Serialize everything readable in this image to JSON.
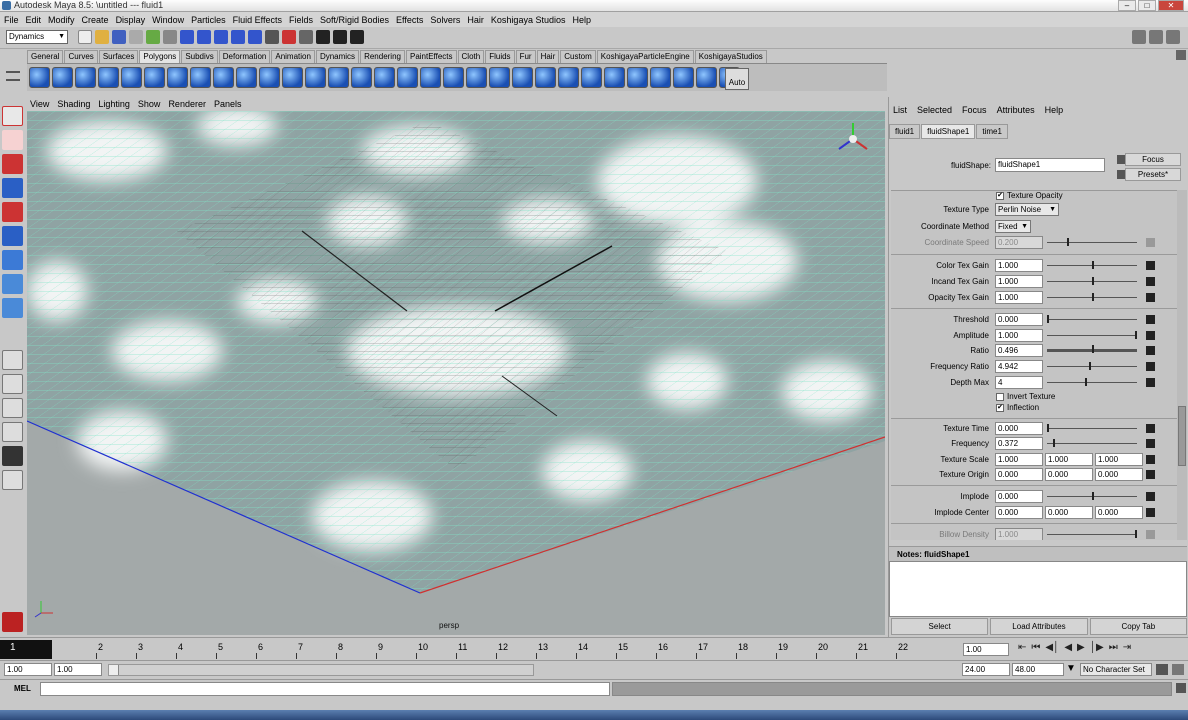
{
  "window": {
    "title": "Autodesk Maya 8.5: \\untitled   ---   fluid1",
    "buttons": [
      "–",
      "□",
      "✕"
    ]
  },
  "menubar": [
    "File",
    "Edit",
    "Modify",
    "Create",
    "Display",
    "Window",
    "Particles",
    "Fluid Effects",
    "Fields",
    "Soft/Rigid Bodies",
    "Effects",
    "Solvers",
    "Hair",
    "Koshigaya Studios",
    "Help"
  ],
  "status_line": {
    "mode": "Dynamics"
  },
  "shelf_tabs": [
    "General",
    "Curves",
    "Surfaces",
    "Polygons",
    "Subdivs",
    "Deformation",
    "Animation",
    "Dynamics",
    "Rendering",
    "PaintEffects",
    "Cloth",
    "Fluids",
    "Fur",
    "Hair",
    "Custom",
    "KoshigayaParticleEngine",
    "KoshigayaStudios"
  ],
  "shelf_active": "Polygons",
  "shelf_label": "Auto",
  "viewport": {
    "menu": [
      "View",
      "Shading",
      "Lighting",
      "Show",
      "Renderer",
      "Panels"
    ],
    "camera_label": "persp"
  },
  "attribute_editor": {
    "menu": [
      "List",
      "Selected",
      "Focus",
      "Attributes",
      "Help"
    ],
    "tabs": [
      "fluid1",
      "fluidShape1",
      "time1"
    ],
    "active_tab": "fluidShape1",
    "shape_label": "fluidShape:",
    "shape_value": "fluidShape1",
    "focus_button": "Focus",
    "presets_button": "Presets*",
    "texture_opacity": "Texture Opacity",
    "texture_type_label": "Texture Type",
    "texture_type_value": "Perlin Noise",
    "coord_method_label": "Coordinate Method",
    "coord_method_value": "Fixed",
    "coord_speed_label": "Coordinate Speed",
    "coord_speed_value": "0.200",
    "color_tex_gain_label": "Color Tex Gain",
    "color_tex_gain_value": "1.000",
    "incand_tex_gain_label": "Incand Tex Gain",
    "incand_tex_gain_value": "1.000",
    "opacity_tex_gain_label": "Opacity Tex Gain",
    "opacity_tex_gain_value": "1.000",
    "threshold_label": "Threshold",
    "threshold_value": "0.000",
    "amplitude_label": "Amplitude",
    "amplitude_value": "1.000",
    "ratio_label": "Ratio",
    "ratio_value": "0.496",
    "frequency_ratio_label": "Frequency Ratio",
    "frequency_ratio_value": "4.942",
    "depth_max_label": "Depth Max",
    "depth_max_value": "4",
    "invert_texture": "Invert Texture",
    "inflection": "Inflection",
    "texture_time_label": "Texture Time",
    "texture_time_value": "0.000",
    "frequency_label": "Frequency",
    "frequency_value": "0.372",
    "texture_scale_label": "Texture Scale",
    "texture_scale_values": [
      "1.000",
      "1.000",
      "1.000"
    ],
    "texture_origin_label": "Texture Origin",
    "texture_origin_values": [
      "0.000",
      "0.000",
      "0.000"
    ],
    "implode_label": "Implode",
    "implode_value": "0.000",
    "implode_center_label": "Implode Center",
    "implode_center_values": [
      "0.000",
      "0.000",
      "0.000"
    ],
    "billow_density_label": "Billow Density",
    "billow_density_value": "1.000",
    "notes_label": "Notes:  fluidShape1",
    "bottom_buttons": [
      "Select",
      "Load Attributes",
      "Copy Tab"
    ]
  },
  "timeline": {
    "current_frame": "1",
    "ticks": [
      "2",
      "3",
      "4",
      "5",
      "6",
      "7",
      "8",
      "9",
      "10",
      "11",
      "12",
      "13",
      "14",
      "15",
      "16",
      "17",
      "18",
      "19",
      "20",
      "21",
      "22"
    ],
    "current_field": "1.00",
    "playback_buttons": [
      "⇤",
      "⏮",
      "◀│",
      "◀",
      "▶",
      "│▶",
      "⏭",
      "⇥"
    ]
  },
  "range": {
    "start": "1.00",
    "start_inner": "1.00",
    "end_inner": "24.00",
    "end": "48.00",
    "character_set": "No Character Set"
  },
  "command_line": {
    "label": "MEL"
  }
}
